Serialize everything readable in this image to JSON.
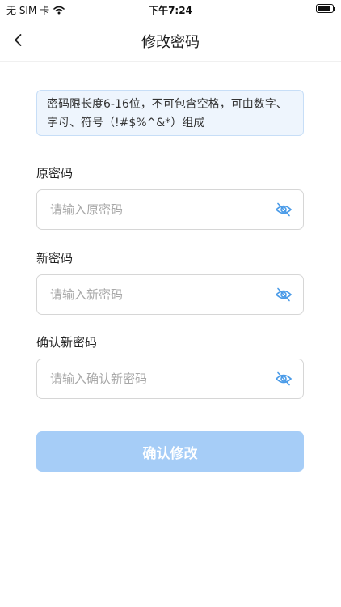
{
  "status_bar": {
    "carrier": "无 SIM 卡",
    "time": "下午7:24",
    "battery_level": 0.9
  },
  "nav": {
    "title": "修改密码"
  },
  "notice": {
    "text": "密码限长度6-16位，不可包含空格，可由数字、字母、符号（!#$%^&*）组成"
  },
  "form": {
    "old_password": {
      "label": "原密码",
      "placeholder": "请输入原密码",
      "value": ""
    },
    "new_password": {
      "label": "新密码",
      "placeholder": "请输入新密码",
      "value": ""
    },
    "confirm_password": {
      "label": "确认新密码",
      "placeholder": "请输入确认新密码",
      "value": ""
    },
    "submit_label": "确认修改"
  },
  "colors": {
    "accent": "#4a9be8",
    "submit_disabled": "#a6cdf7",
    "notice_bg": "#eef5fd",
    "notice_border": "#c7def7"
  },
  "icons": {
    "back": "chevron-left-icon",
    "toggle_visibility": "eye-slash-icon",
    "wifi": "wifi-icon",
    "battery": "battery-icon"
  }
}
